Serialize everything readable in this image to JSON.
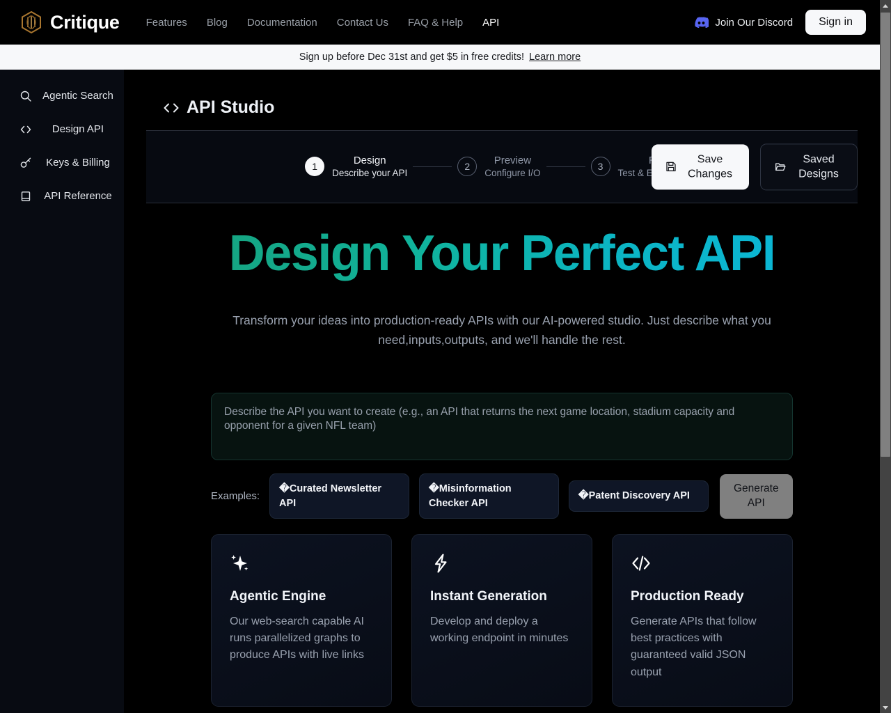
{
  "colors": {
    "page_bg": "#000000",
    "sidebar_bg": "#080b12",
    "banner_bg": "#f7f8fa",
    "accent_gradient_start": "#16a37f",
    "accent_gradient_end": "#0bb6d6",
    "discord_brand": "#5865f2",
    "logo_gold": "#a9762f",
    "disabled_button": "#808080"
  },
  "topnav": {
    "brand": "Critique",
    "logo_icon": "hexagon-logo-icon",
    "links": [
      {
        "label": "Features",
        "active": false
      },
      {
        "label": "Blog",
        "active": false
      },
      {
        "label": "Documentation",
        "active": false
      },
      {
        "label": "Contact Us",
        "active": false
      },
      {
        "label": "FAQ & Help",
        "active": false
      },
      {
        "label": "API",
        "active": true
      }
    ],
    "discord": {
      "label": "Join Our Discord",
      "icon": "discord-icon"
    },
    "signin": "Sign in"
  },
  "banner": {
    "text": "Sign up before Dec 31st and get $5 in free credits!",
    "link": "Learn more"
  },
  "sidebar": {
    "items": [
      {
        "label": "Agentic Search",
        "icon": "search-icon"
      },
      {
        "label": "Design API",
        "icon": "code-brackets-icon"
      },
      {
        "label": "Keys & Billing",
        "icon": "key-icon"
      },
      {
        "label": "API Reference",
        "icon": "book-icon"
      }
    ]
  },
  "studio": {
    "icon": "code-brackets-icon",
    "title": "API Studio"
  },
  "stepper": {
    "steps": [
      {
        "number": "1",
        "name": "Design",
        "sub": "Describe your API",
        "state": "on"
      },
      {
        "number": "2",
        "name": "Preview",
        "sub": "Configure I/O",
        "state": "off"
      },
      {
        "number": "3",
        "name": "Run",
        "sub": "Test & Export Code",
        "state": "off"
      }
    ],
    "save_changes": {
      "label": "Save Changes",
      "icon": "floppy-disk-icon"
    },
    "saved_designs": {
      "label": "Saved Designs",
      "icon": "folder-open-icon"
    }
  },
  "hero": {
    "title": "Design Your Perfect API",
    "subtitle": "Transform your ideas into production-ready APIs with our AI-powered studio. Just describe what you need,inputs,outputs, and we'll handle the rest."
  },
  "prompt": {
    "value": "",
    "placeholder": "Describe the API you want to create (e.g., an API that returns the next game location, stadium capacity and opponent for a given NFL team)"
  },
  "examples": {
    "label": "Examples:",
    "chips": [
      {
        "icon": "�",
        "label": "Curated Newsletter API"
      },
      {
        "icon": "�",
        "label": "Misinformation Checker API"
      },
      {
        "icon": "�",
        "label": "Patent Discovery API"
      }
    ],
    "generate_button": "Generate API"
  },
  "cards": [
    {
      "icon": "sparkles-icon",
      "title": "Agentic Engine",
      "desc": "Our web-search capable AI runs parallelized graphs to produce APIs with live links"
    },
    {
      "icon": "lightning-bolt-icon",
      "title": "Instant Generation",
      "desc": "Develop and deploy a working endpoint in minutes"
    },
    {
      "icon": "code-slash-icon",
      "title": "Production Ready",
      "desc": "Generate APIs that follow best practices with guaranteed valid JSON output"
    }
  ],
  "scrollbar": {
    "up_arrow": "scroll-up-arrow",
    "down_arrow": "scroll-down-arrow"
  }
}
